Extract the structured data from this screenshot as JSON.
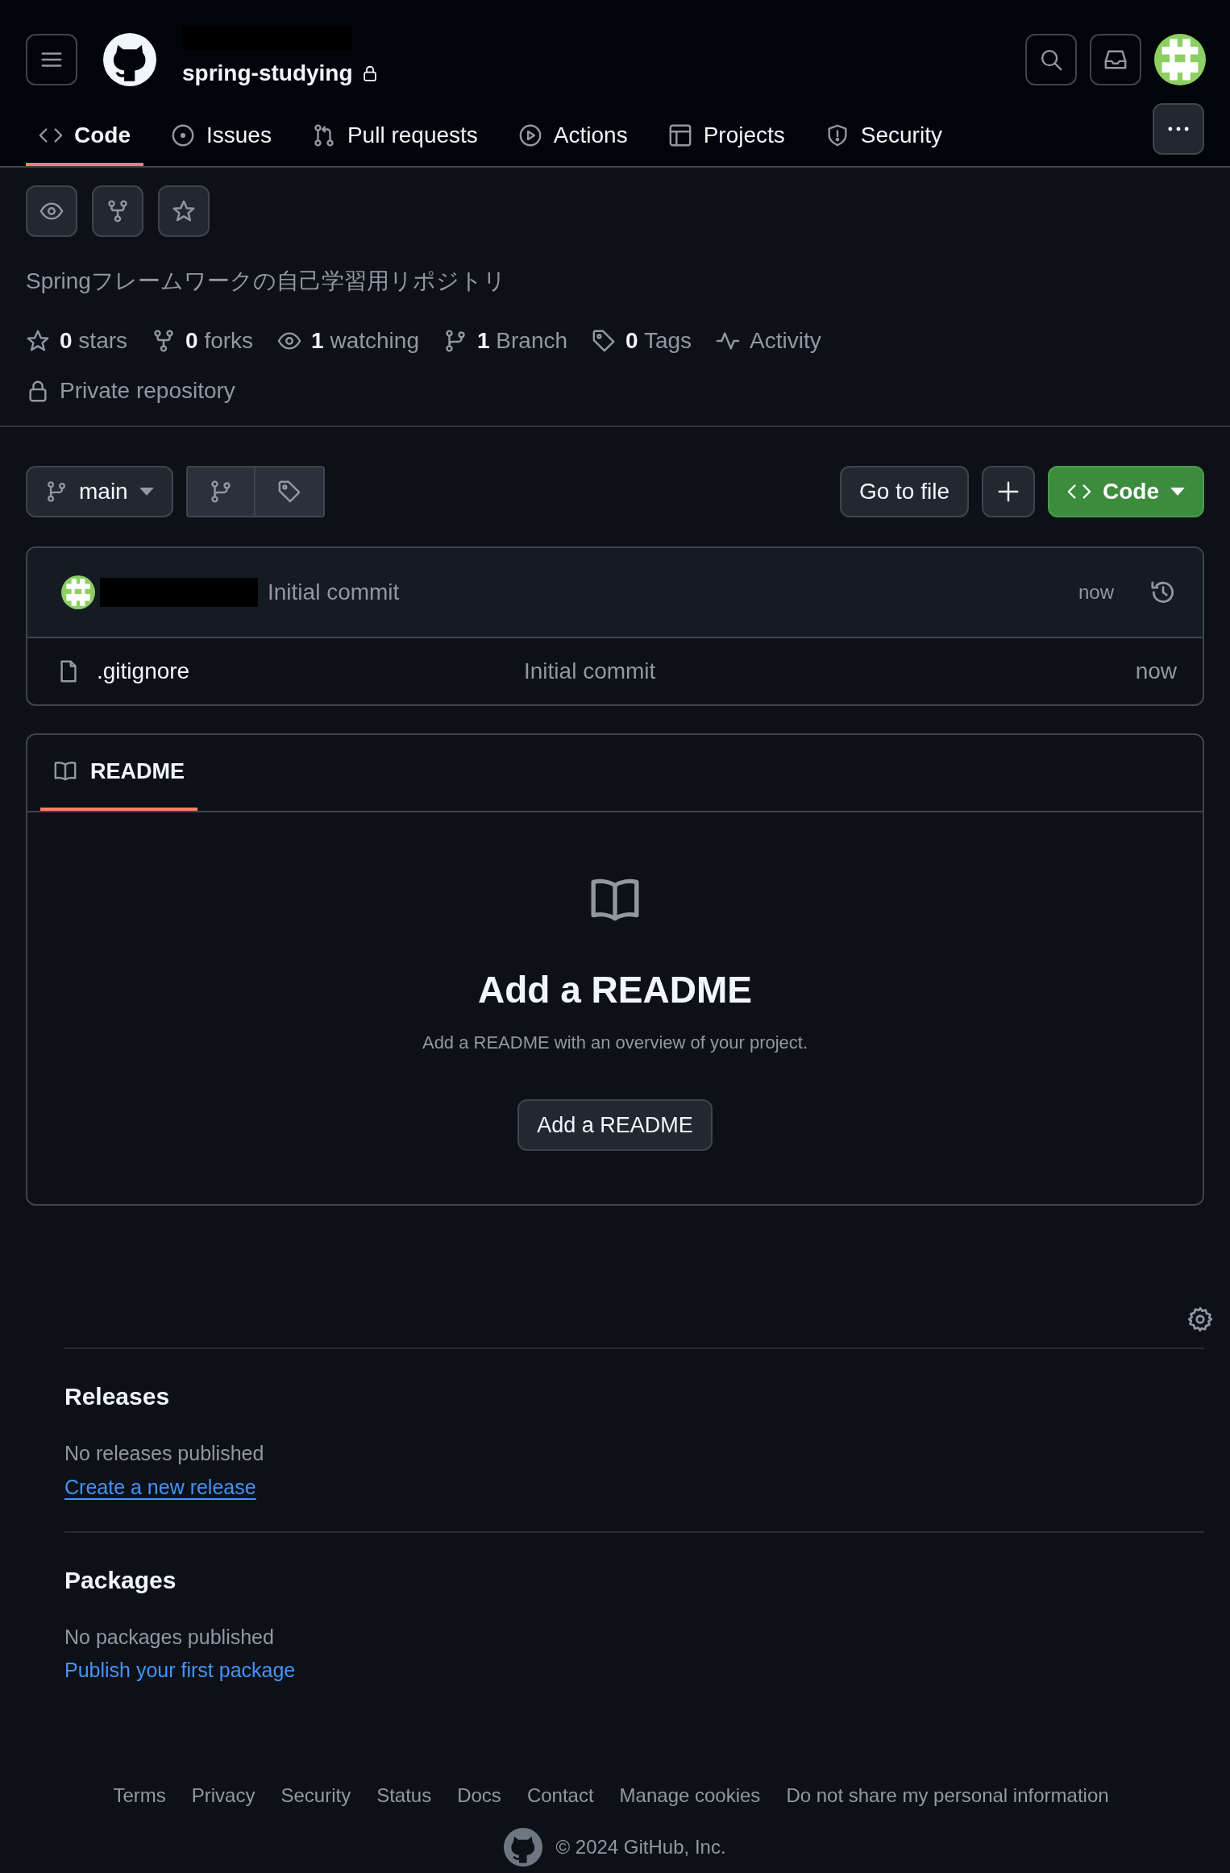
{
  "header": {
    "repo_name": "spring-studying"
  },
  "tabs": [
    {
      "label": "Code",
      "kind": "code",
      "selected": true
    },
    {
      "label": "Issues",
      "kind": "issue",
      "selected": false
    },
    {
      "label": "Pull requests",
      "kind": "pr",
      "selected": false
    },
    {
      "label": "Actions",
      "kind": "play",
      "selected": false
    },
    {
      "label": "Projects",
      "kind": "table",
      "selected": false
    },
    {
      "label": "Security",
      "kind": "shield",
      "selected": false
    }
  ],
  "description": "Springフレームワークの自己学習用リポジトリ",
  "stats": [
    {
      "kind": "star",
      "count": "0",
      "label": "stars"
    },
    {
      "kind": "fork",
      "count": "0",
      "label": "forks"
    },
    {
      "kind": "eye",
      "count": "1",
      "label": "watching"
    },
    {
      "kind": "branch",
      "count": "1",
      "label": "Branch"
    },
    {
      "kind": "tag",
      "count": "0",
      "label": "Tags"
    },
    {
      "kind": "pulse",
      "label": "Activity"
    }
  ],
  "visibility": "Private repository",
  "branch": "main",
  "go_to_file": "Go to file",
  "code_button": "Code",
  "latest_commit": {
    "message": "Initial commit",
    "time": "now"
  },
  "files": [
    {
      "name": ".gitignore",
      "message": "Initial commit",
      "time": "now"
    }
  ],
  "readme": {
    "tab": "README",
    "title": "Add a README",
    "subtitle": "Add a README with an overview of your project.",
    "button": "Add a README"
  },
  "sidebar": [
    {
      "title": "Releases",
      "note": "No releases published",
      "link": "Create a new release",
      "underlined": true
    },
    {
      "title": "Packages",
      "note": "No packages published",
      "link": "Publish your first package",
      "underlined": false
    }
  ],
  "footer": {
    "links": [
      "Terms",
      "Privacy",
      "Security",
      "Status",
      "Docs",
      "Contact",
      "Manage cookies",
      "Do not share my personal information"
    ],
    "copyright": "© 2024 GitHub, Inc."
  }
}
